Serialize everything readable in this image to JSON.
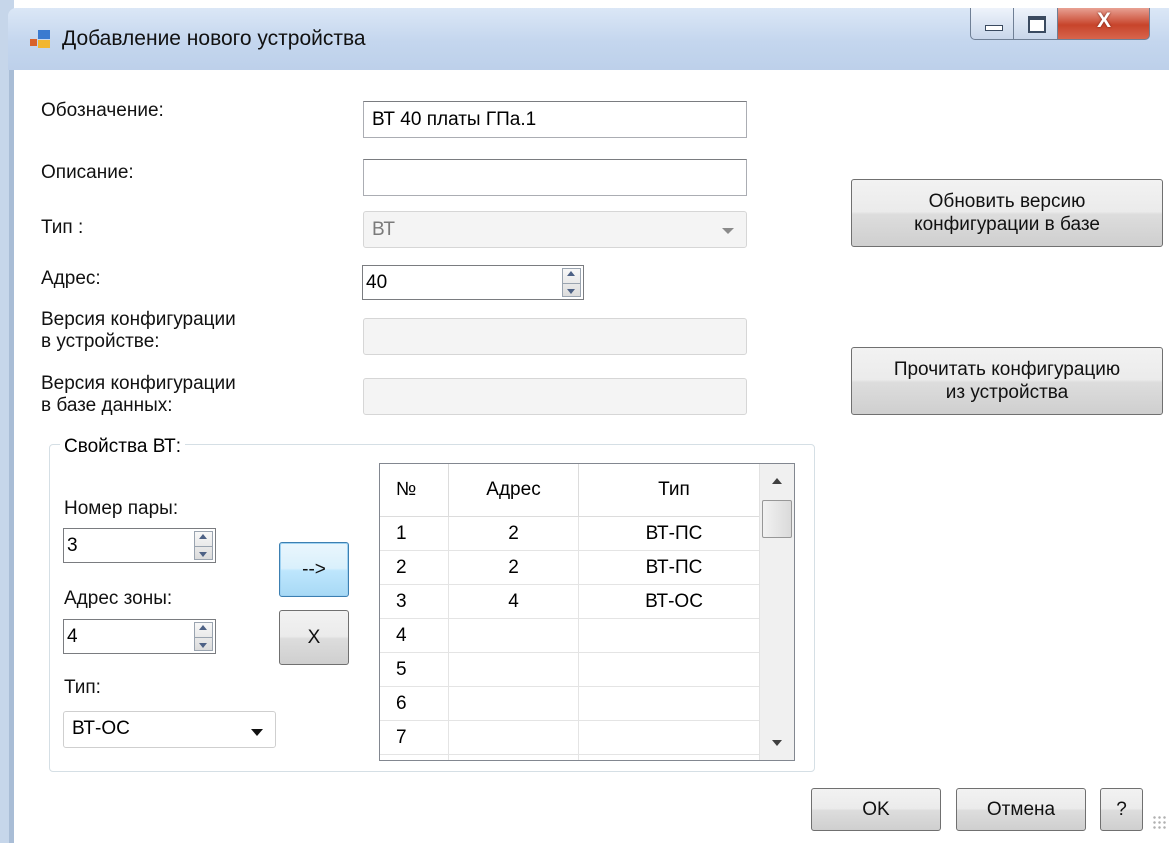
{
  "window": {
    "title": "Добавление нового устройства",
    "close_glyph": "X"
  },
  "form": {
    "designation_label": "Обозначение:",
    "designation_value": "ВТ 40 платы ГПа.1",
    "description_label": "Описание:",
    "description_value": "",
    "type_label": "Тип :",
    "type_value": "ВТ",
    "address_label": "Адрес:",
    "address_value": "40",
    "device_config_version_label": "Версия  конфигурации\nв устройстве:",
    "device_config_version_value": "",
    "db_config_version_label": "Версия  конфигурации\nв базе данных:",
    "db_config_version_value": ""
  },
  "buttons": {
    "update_config_version": "Обновить версию\nконфигурации в базе",
    "read_config": "Прочитать конфигурацию\nиз устройства",
    "add_arrow": "-->",
    "remove": "X",
    "ok": "OK",
    "cancel": "Отмена",
    "help": "?"
  },
  "vt_properties": {
    "group_title": "Свойства ВТ:",
    "pair_number_label": "Номер пары:",
    "pair_number_value": "3",
    "zone_address_label": "Адрес зоны:",
    "zone_address_value": "4",
    "type_label": "Тип:",
    "type_value": "ВТ-ОС"
  },
  "grid": {
    "columns": [
      "№",
      "Адрес",
      "Тип"
    ],
    "rows": [
      [
        "1",
        "2",
        "ВТ-ПС"
      ],
      [
        "2",
        "2",
        "ВТ-ПС"
      ],
      [
        "3",
        "4",
        "ВТ-ОС"
      ],
      [
        "4",
        "",
        ""
      ],
      [
        "5",
        "",
        ""
      ],
      [
        "6",
        "",
        ""
      ],
      [
        "7",
        "",
        ""
      ],
      [
        "",
        "",
        ""
      ]
    ]
  },
  "colors": {
    "titlebar": "#c4d6ee",
    "close_button": "#c7442b",
    "focus_border": "#3c7fb1"
  }
}
